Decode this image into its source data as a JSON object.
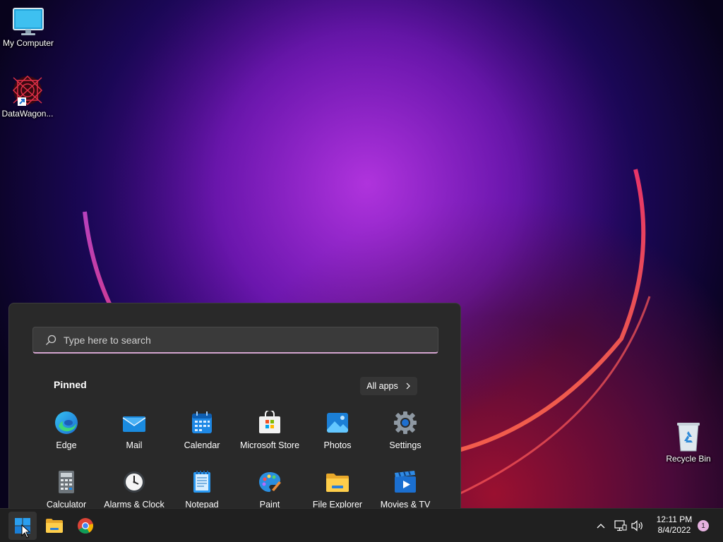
{
  "desktop": {
    "icons": [
      {
        "label": "My Computer",
        "icon": "monitor-icon"
      },
      {
        "label": "DataWagon...",
        "icon": "datawagon-icon"
      },
      {
        "label": "Recycle Bin",
        "icon": "recycle-bin-icon"
      }
    ]
  },
  "start_menu": {
    "search_placeholder": "Type here to search",
    "pinned_heading": "Pinned",
    "all_apps_label": "All apps",
    "pinned_apps": [
      {
        "label": "Edge",
        "icon": "edge-icon"
      },
      {
        "label": "Mail",
        "icon": "mail-icon"
      },
      {
        "label": "Calendar",
        "icon": "calendar-icon"
      },
      {
        "label": "Microsoft Store",
        "icon": "store-icon"
      },
      {
        "label": "Photos",
        "icon": "photos-icon"
      },
      {
        "label": "Settings",
        "icon": "settings-icon"
      },
      {
        "label": "Calculator",
        "icon": "calculator-icon"
      },
      {
        "label": "Alarms & Clock",
        "icon": "clock-icon"
      },
      {
        "label": "Notepad",
        "icon": "notepad-icon"
      },
      {
        "label": "Paint",
        "icon": "paint-icon"
      },
      {
        "label": "File Explorer",
        "icon": "folder-icon"
      },
      {
        "label": "Movies & TV",
        "icon": "movies-icon"
      }
    ]
  },
  "taskbar": {
    "apps": [
      {
        "icon": "windows-start-icon"
      },
      {
        "icon": "file-explorer-icon"
      },
      {
        "icon": "chrome-icon"
      }
    ],
    "tray": {
      "time": "12:11 PM",
      "date": "8/4/2022",
      "notification_count": "1"
    }
  },
  "colors": {
    "accent": "#0078d4",
    "taskbar_bg": "#202020",
    "start_bg": "#292929",
    "search_underline": "#d4a5cf"
  }
}
